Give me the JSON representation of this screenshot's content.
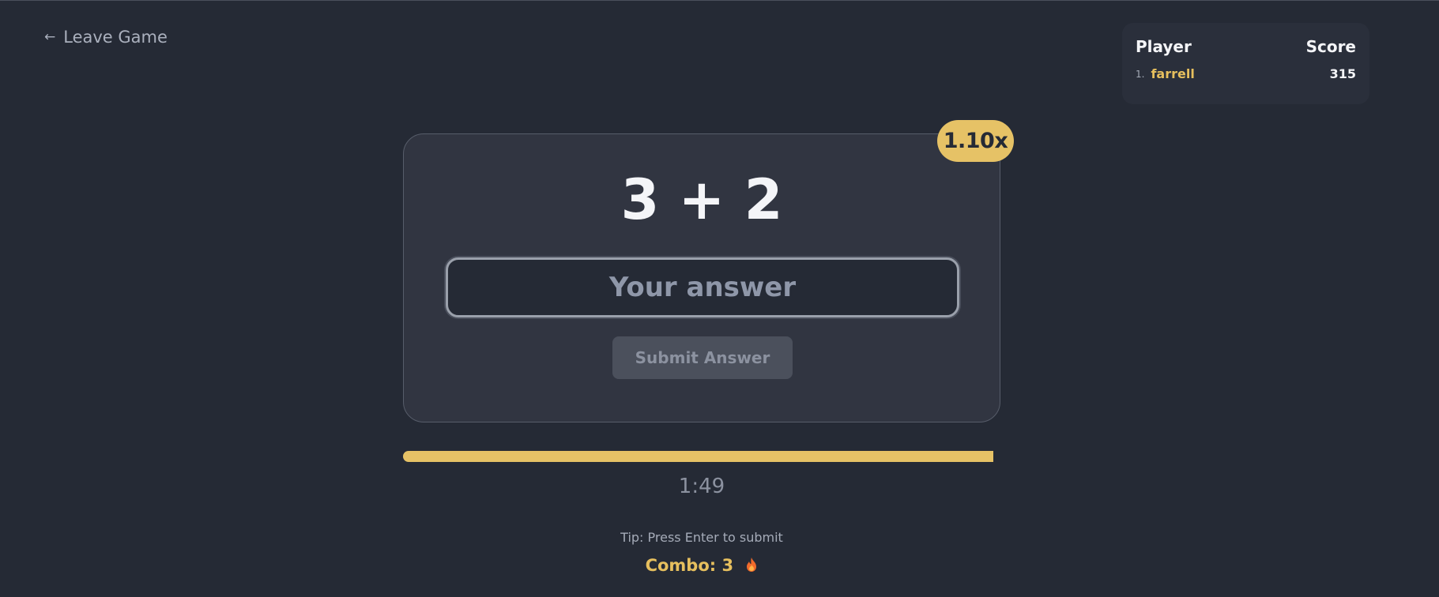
{
  "header": {
    "leave_label": "Leave Game",
    "leave_icon": "arrow-left-icon"
  },
  "leaderboard": {
    "player_header": "Player",
    "score_header": "Score",
    "rows": [
      {
        "rank": "1.",
        "name": "farrell",
        "score": "315"
      }
    ]
  },
  "game": {
    "multiplier": "1.10x",
    "question": "3 + 2",
    "answer_value": "",
    "answer_placeholder": "Your answer",
    "submit_label": "Submit Answer",
    "time_remaining_fraction": 1.0,
    "timer": "1:49",
    "tip": "Tip: Press Enter to submit",
    "combo": "Combo: 3",
    "combo_icon": "fire-icon"
  },
  "colors": {
    "background": "#252a35",
    "card": "#313541",
    "accent": "#e6c266",
    "text": "#f4f5f8",
    "muted": "#8c92a0"
  }
}
